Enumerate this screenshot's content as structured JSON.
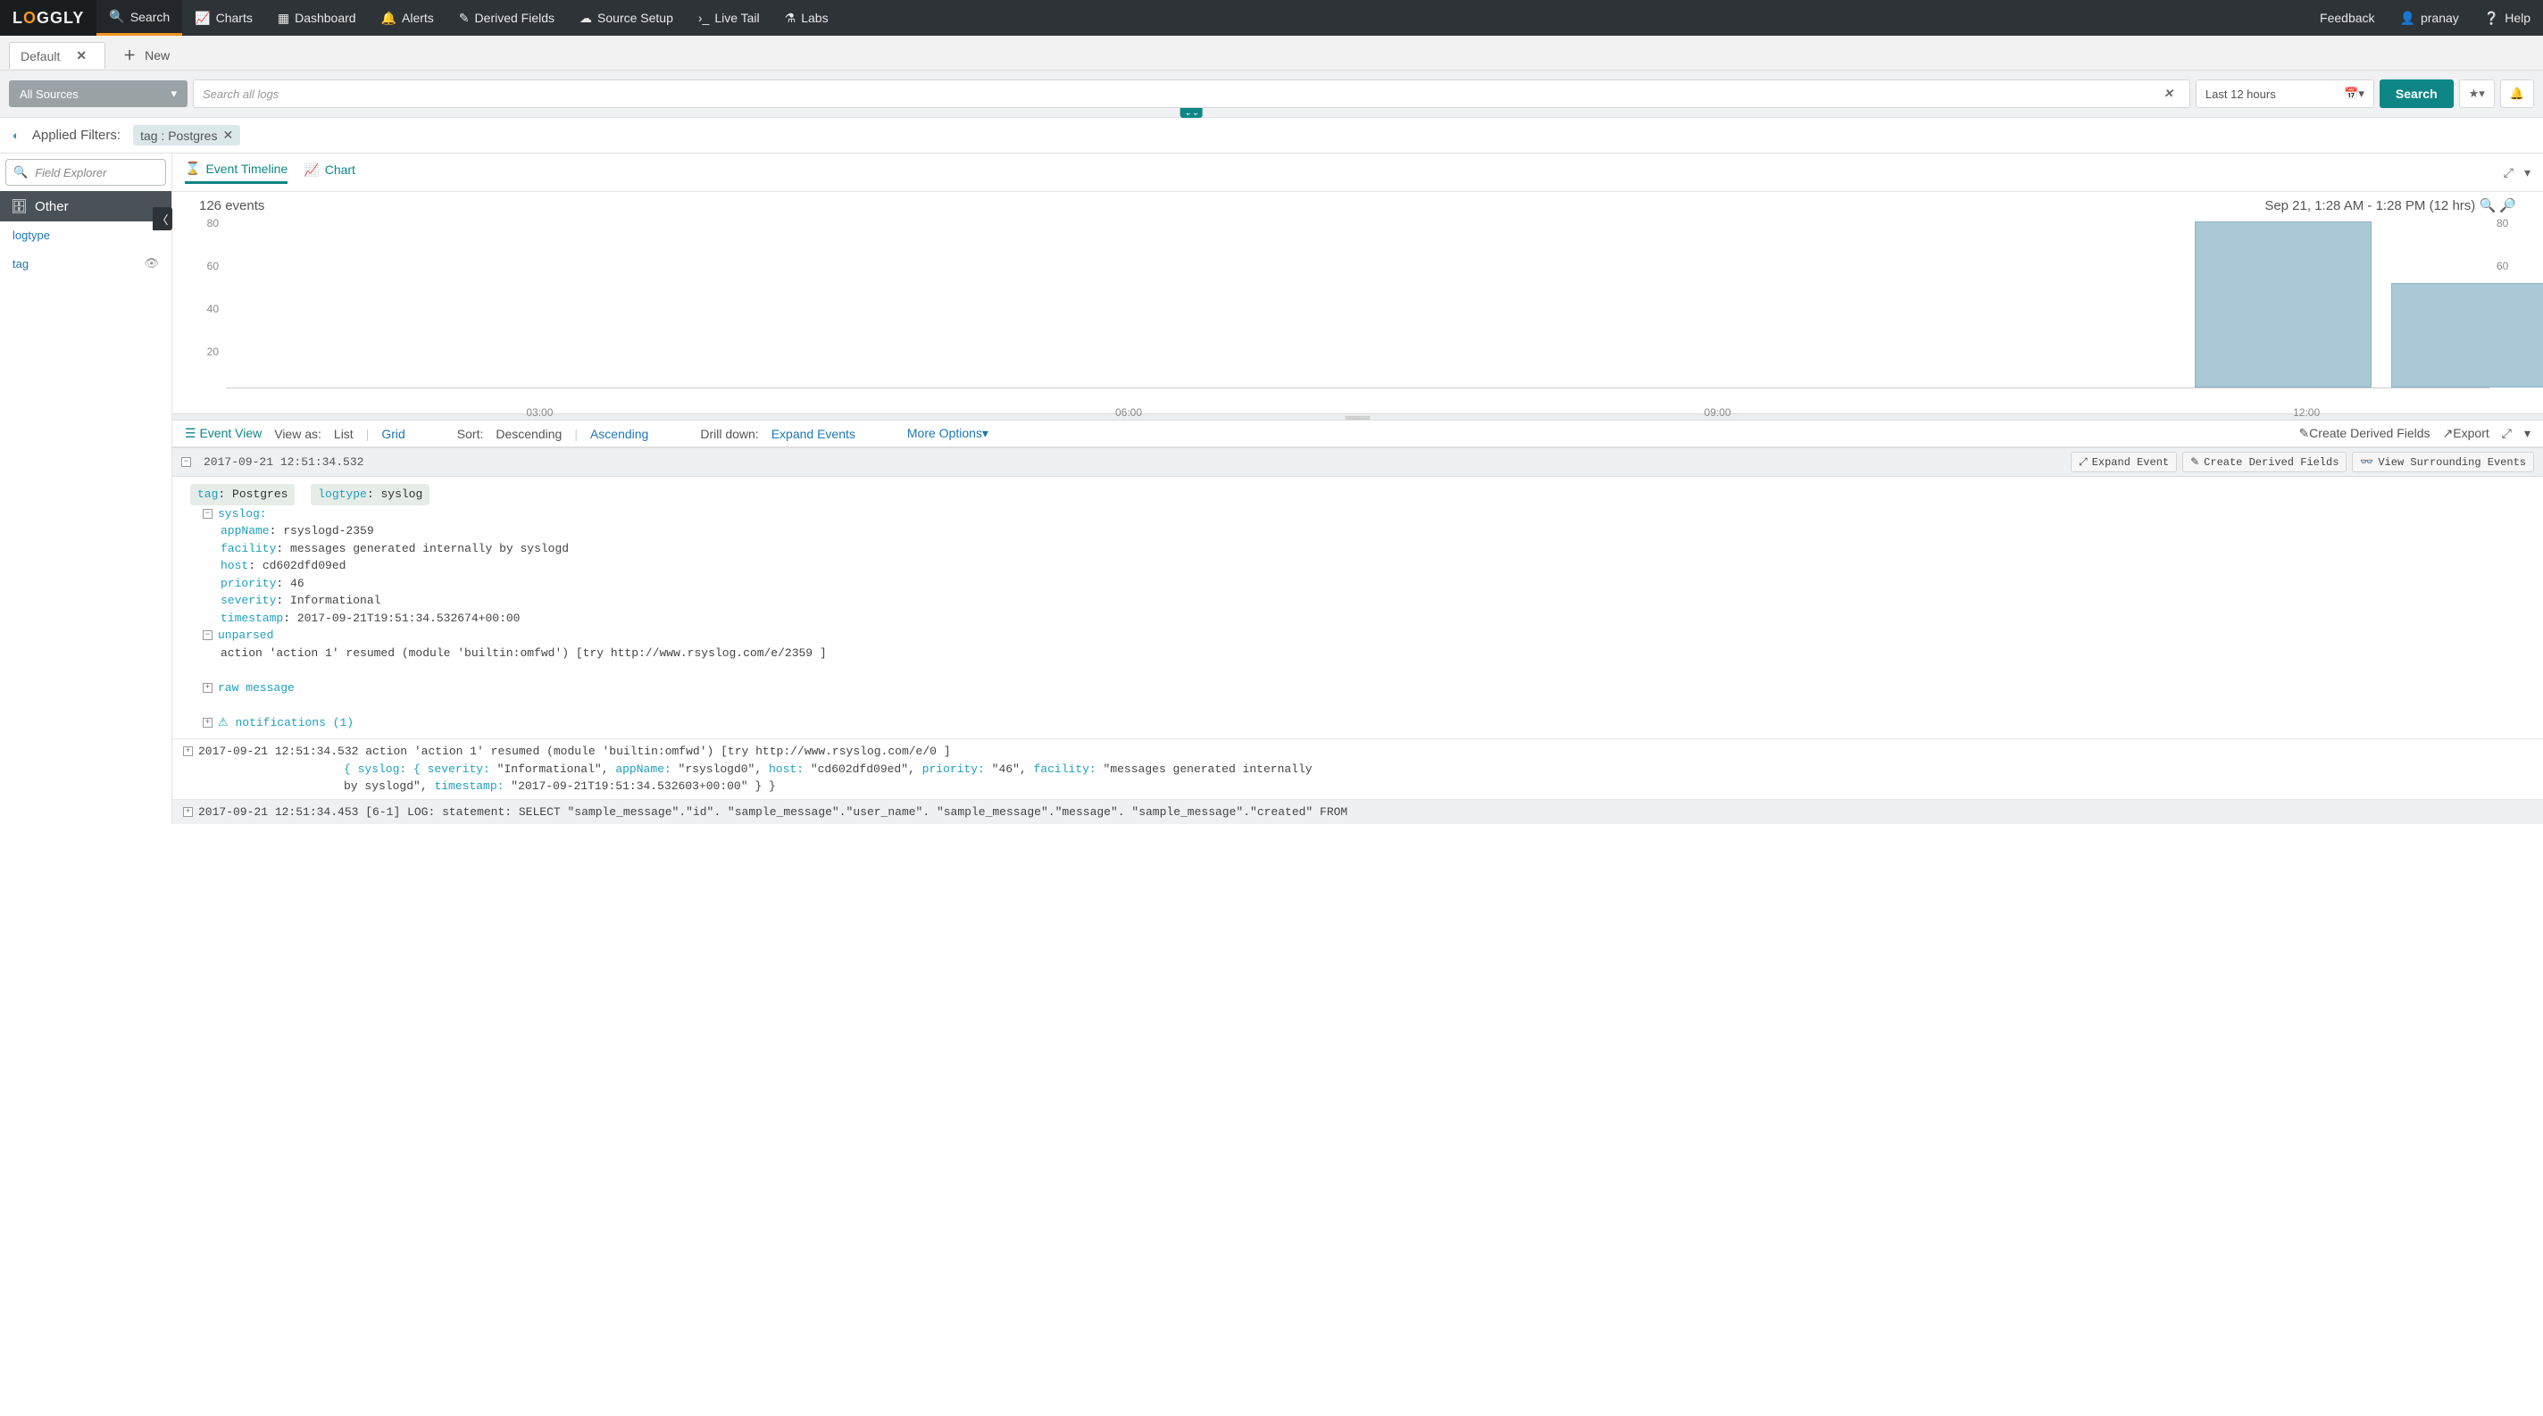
{
  "brand": {
    "text": "LOGGLY",
    "accent_char": "O"
  },
  "topnav": {
    "items": [
      {
        "label": "Search",
        "icon": "search-icon",
        "active": true
      },
      {
        "label": "Charts",
        "icon": "chart-icon"
      },
      {
        "label": "Dashboard",
        "icon": "dashboard-icon"
      },
      {
        "label": "Alerts",
        "icon": "bell-icon"
      },
      {
        "label": "Derived Fields",
        "icon": "wand-icon"
      },
      {
        "label": "Source Setup",
        "icon": "cloud-icon"
      },
      {
        "label": "Live Tail",
        "icon": "terminal-icon"
      },
      {
        "label": "Labs",
        "icon": "flask-icon"
      }
    ],
    "right": [
      {
        "label": "Feedback"
      },
      {
        "label": "pranay",
        "icon": "user-icon"
      },
      {
        "label": "Help",
        "icon": "help-icon"
      }
    ]
  },
  "tabs": {
    "items": [
      {
        "label": "Default"
      }
    ],
    "new_label": "New"
  },
  "search": {
    "sources": "All Sources",
    "placeholder": "Search all logs",
    "time": "Last 12 hours",
    "button": "Search"
  },
  "filters": {
    "label": "Applied Filters:",
    "chips": [
      {
        "key": "tag",
        "value": "Postgres"
      }
    ]
  },
  "sidebar": {
    "field_explorer_placeholder": "Field Explorer",
    "section": "Other",
    "links": [
      {
        "label": "logtype"
      },
      {
        "label": "tag"
      }
    ]
  },
  "timeline": {
    "tabs": [
      {
        "label": "Event Timeline",
        "active": true
      },
      {
        "label": "Chart"
      }
    ],
    "count_text": "126 events",
    "range_text": "Sep 21, 1:28 AM - 1:28 PM  (12 hrs)"
  },
  "chart_data": {
    "type": "bar",
    "ylim": [
      0,
      80
    ],
    "y_ticks": [
      80,
      60,
      40,
      20
    ],
    "x_ticks": [
      "03:00",
      "06:00",
      "09:00",
      "12:00"
    ],
    "x_end_hour": 13,
    "bars": [
      {
        "x_hour": 11.5,
        "value": 78
      },
      {
        "x_hour": 12.5,
        "value": 49
      }
    ]
  },
  "eventbar": {
    "event_view": "Event View",
    "view_as": "View as:",
    "list": "List",
    "grid": "Grid",
    "sort": "Sort:",
    "descending": "Descending",
    "ascending": "Ascending",
    "drilldown": "Drill down:",
    "expand_events": "Expand Events",
    "more": "More Options",
    "create_derived": "Create Derived Fields",
    "export": "Export"
  },
  "expanded_event": {
    "timestamp": "2017-09-21 12:51:34.532",
    "actions": {
      "expand": "Expand Event",
      "create": "Create Derived Fields",
      "surrounding": "View Surrounding Events"
    },
    "tags": [
      {
        "k": "tag",
        "v": "Postgres"
      },
      {
        "k": "logtype",
        "v": "syslog"
      }
    ],
    "syslog_label": "syslog:",
    "fields": [
      {
        "k": "appName",
        "v": "rsyslogd-2359"
      },
      {
        "k": "facility",
        "v": "messages generated internally by syslogd"
      },
      {
        "k": "host",
        "v": "cd602dfd09ed"
      },
      {
        "k": "priority",
        "v": "46"
      },
      {
        "k": "severity",
        "v": "Informational"
      },
      {
        "k": "timestamp",
        "v": "2017-09-21T19:51:34.532674+00:00"
      }
    ],
    "unparsed_label": "unparsed",
    "unparsed_text": "action 'action 1' resumed (module 'builtin:omfwd') [try http://www.rsyslog.com/e/2359 ]",
    "raw_label": "raw message",
    "notifications_label": "notifications (1)"
  },
  "collapsed_events": [
    {
      "ts": "2017-09-21 12:51:34.532",
      "head": "action 'action 1' resumed (module 'builtin:omfwd') [try http://www.rsyslog.com/e/0 ]",
      "json_line1": "{ syslog: { severity: \"Informational\", appName: \"rsyslogd0\", host: \"cd602dfd09ed\", priority: \"46\", facility: \"messages generated internally",
      "json_line2": "by syslogd\", timestamp: \"2017-09-21T19:51:34.532603+00:00\" } }"
    },
    {
      "ts": "2017-09-21 12:51:34.453",
      "head": "[6-1] LOG: statement: SELECT \"sample_message\".\"id\". \"sample_message\".\"user_name\". \"sample_message\".\"message\". \"sample_message\".\"created\" FROM"
    }
  ]
}
